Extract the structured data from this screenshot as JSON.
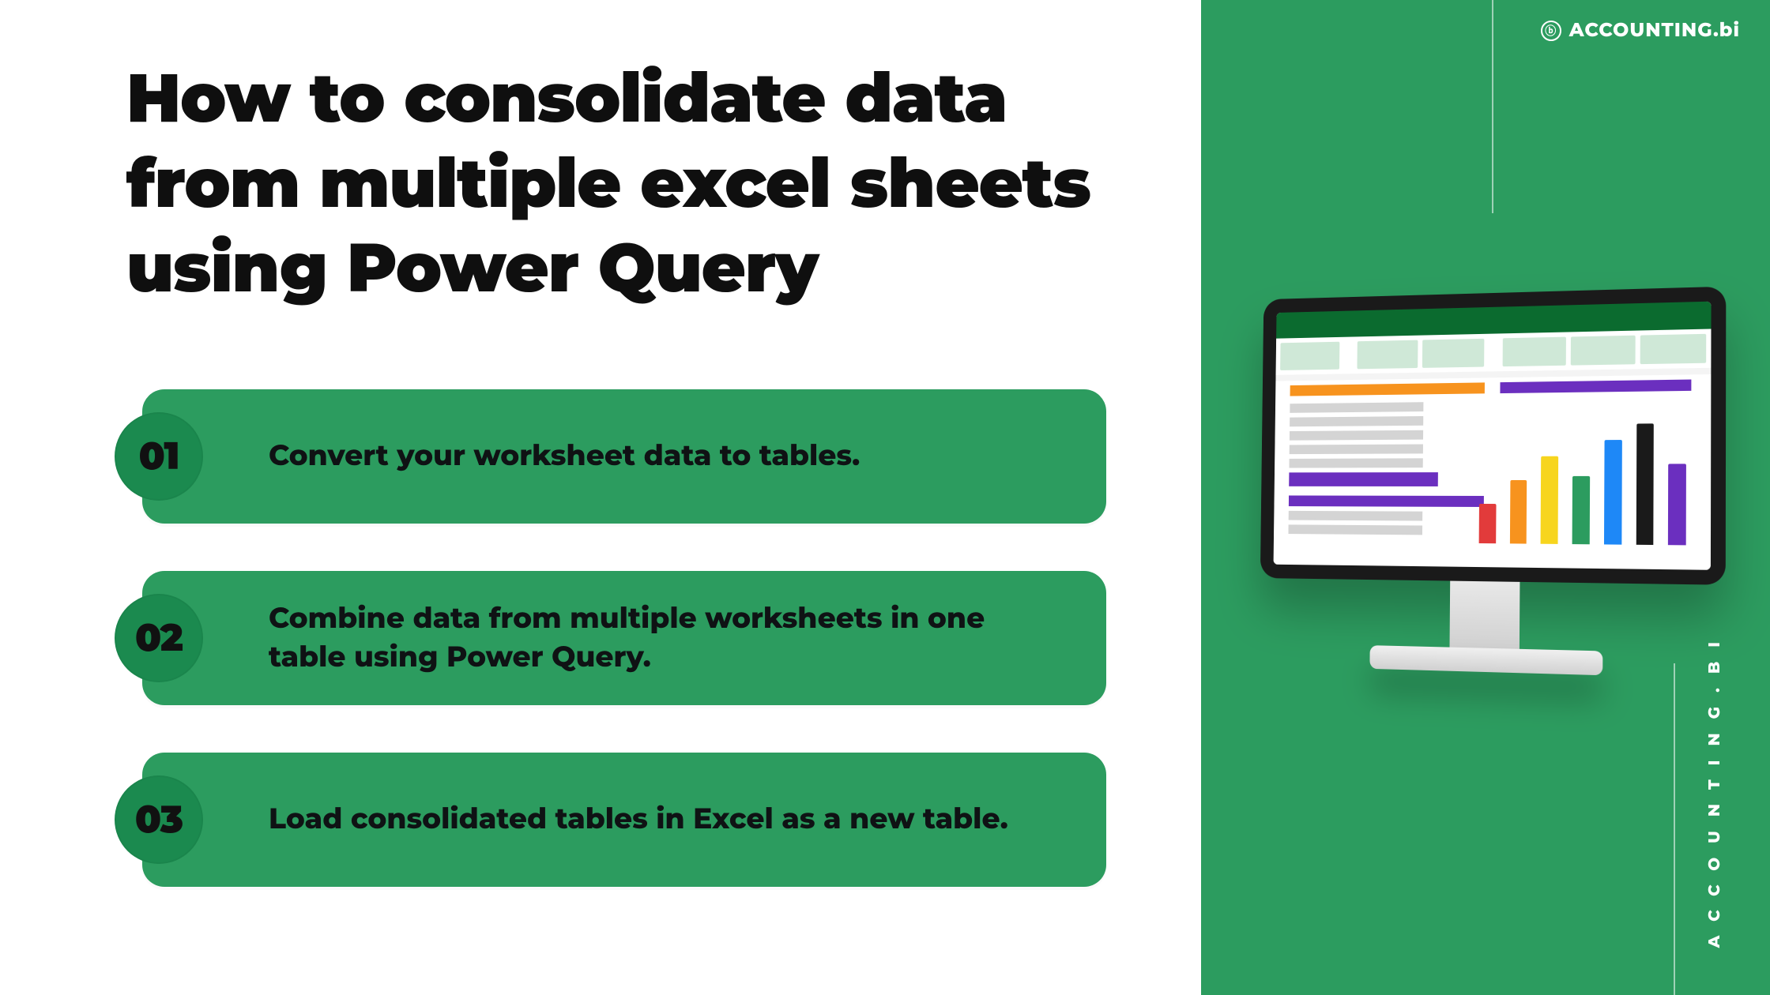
{
  "title": "How to consolidate data from multiple excel sheets using Power Query",
  "brand": {
    "top_label": "ACCOUNTING.bi",
    "side_label": "ACCOUNTING.BI",
    "icon_glyph": "ⓑ"
  },
  "steps": [
    {
      "number": "01",
      "text": "Convert your worksheet data to tables."
    },
    {
      "number": "02",
      "text": "Combine data from multiple worksheets in one table using Power Query."
    },
    {
      "number": "03",
      "text": "Load consolidated tables in Excel as a new table."
    }
  ],
  "colors": {
    "accent_green": "#2c9c5f",
    "badge_green": "#1b8a4f"
  }
}
